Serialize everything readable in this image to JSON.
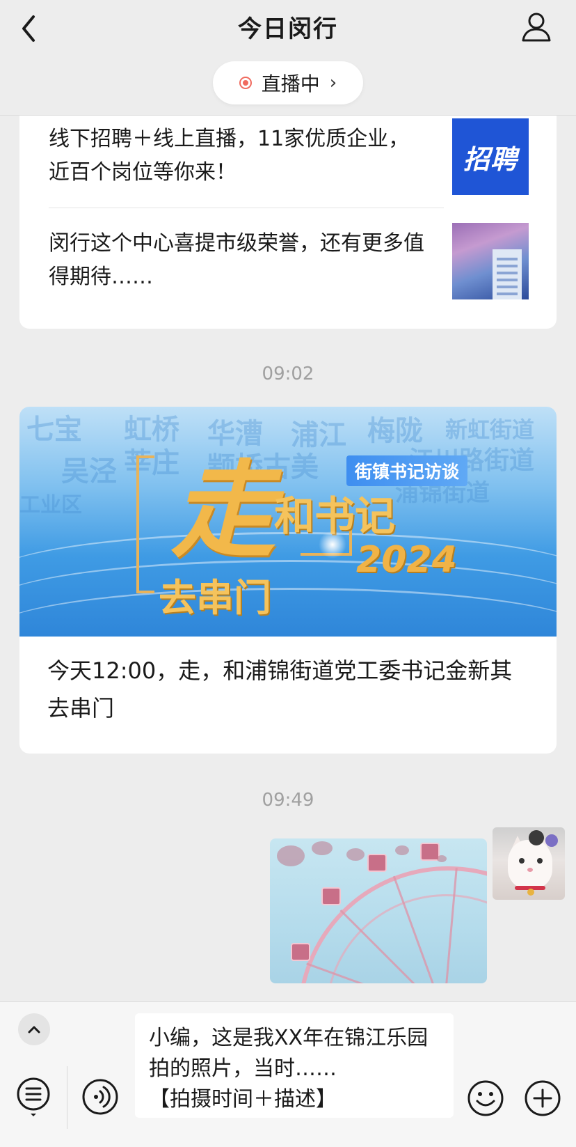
{
  "header": {
    "title": "今日闵行",
    "live_label": "直播中",
    "live_chevron": "›"
  },
  "messages": {
    "news_items": [
      {
        "text": "线下招聘＋线上直播，11家优质企业，近百个岗位等你来！",
        "thumb_text": "招聘"
      },
      {
        "text": "闵行这个中心喜提市级荣誉，还有更多值得期待……"
      }
    ],
    "time1": "09:02",
    "article": {
      "banner": {
        "zou": "走",
        "he": "和书记",
        "qu": "去串门",
        "year": "2024",
        "tag": "街镇书记访谈",
        "bg_words": [
          "七宝",
          "虹桥",
          "华漕",
          "浦江",
          "梅陇",
          "新虹街道",
          "吴泾",
          "莘庄",
          "颛桥",
          "古美",
          "江川路街道",
          "浦锦街道",
          "工业区"
        ]
      },
      "title": "今天12:00，走，和浦锦街道党工委书记金新其去串门"
    },
    "time2": "09:49"
  },
  "input_bar": {
    "draft_text": "小编，这是我XX年在锦江乐园拍的照片，当时……\n【拍摄时间＋描述】",
    "collapse_chevron": "˄"
  },
  "icons": {
    "back": "back-chevron-icon",
    "profile": "person-icon",
    "live": "live-record-icon",
    "menu": "menu-list-icon",
    "voice": "voice-icon",
    "emoji": "emoji-icon",
    "plus": "plus-icon"
  },
  "colors": {
    "background": "#ededed",
    "live_red": "#f06a5e",
    "thumb_blue": "#1f55d6",
    "banner_gold": "#f2b84a"
  }
}
